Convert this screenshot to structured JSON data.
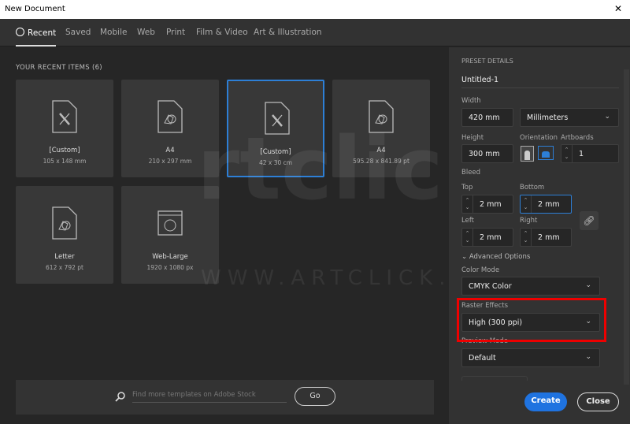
{
  "window": {
    "title": "New Document",
    "close": "✕"
  },
  "tabs": [
    {
      "label": "Recent",
      "active": true
    },
    {
      "label": "Saved"
    },
    {
      "label": "Mobile"
    },
    {
      "label": "Web"
    },
    {
      "label": "Print"
    },
    {
      "label": "Film & Video"
    },
    {
      "label": "Art & Illustration"
    }
  ],
  "recent": {
    "heading": "YOUR RECENT ITEMS  (6)",
    "items": [
      {
        "name": "[Custom]",
        "size": "105 x 148 mm",
        "icon": "custom-doc-icon"
      },
      {
        "name": "A4",
        "size": "210 x 297 mm",
        "icon": "print-doc-icon"
      },
      {
        "name": "[Custom]",
        "size": "42 x 30 cm",
        "icon": "custom-doc-icon",
        "selected": true
      },
      {
        "name": "A4",
        "size": "595.28 x 841.89 pt",
        "icon": "print-doc-icon"
      },
      {
        "name": "Letter",
        "size": "612 x 792 pt",
        "icon": "print-doc-icon"
      },
      {
        "name": "Web-Large",
        "size": "1920 x 1080 px",
        "icon": "web-doc-icon"
      }
    ]
  },
  "search": {
    "placeholder": "Find more templates on Adobe Stock",
    "go": "Go"
  },
  "preset": {
    "heading": "PRESET DETAILS",
    "name": "Untitled-1",
    "width_label": "Width",
    "width": "420 mm",
    "units": "Millimeters",
    "height_label": "Height",
    "height": "300 mm",
    "orientation_label": "Orientation",
    "orientation": "landscape",
    "artboards_label": "Artboards",
    "artboards": "1",
    "bleed_label": "Bleed",
    "top_label": "Top",
    "top": "2 mm",
    "bottom_label": "Bottom",
    "bottom": "2 mm",
    "left_label": "Left",
    "left": "2 mm",
    "right_label": "Right",
    "right": "2 mm",
    "advanced": "Advanced Options",
    "color_mode_label": "Color Mode",
    "color_mode": "CMYK Color",
    "raster_label": "Raster Effects",
    "raster": "High (300 ppi)",
    "preview_label": "Preview Mode",
    "preview": "Default"
  },
  "actions": {
    "create": "Create",
    "close": "Close"
  },
  "colors": {
    "accent": "#2d7fd6",
    "highlight": "#e00000"
  },
  "watermark": {
    "logo": "rtclick",
    "url": "WWW.ARTCLICK.VN"
  }
}
